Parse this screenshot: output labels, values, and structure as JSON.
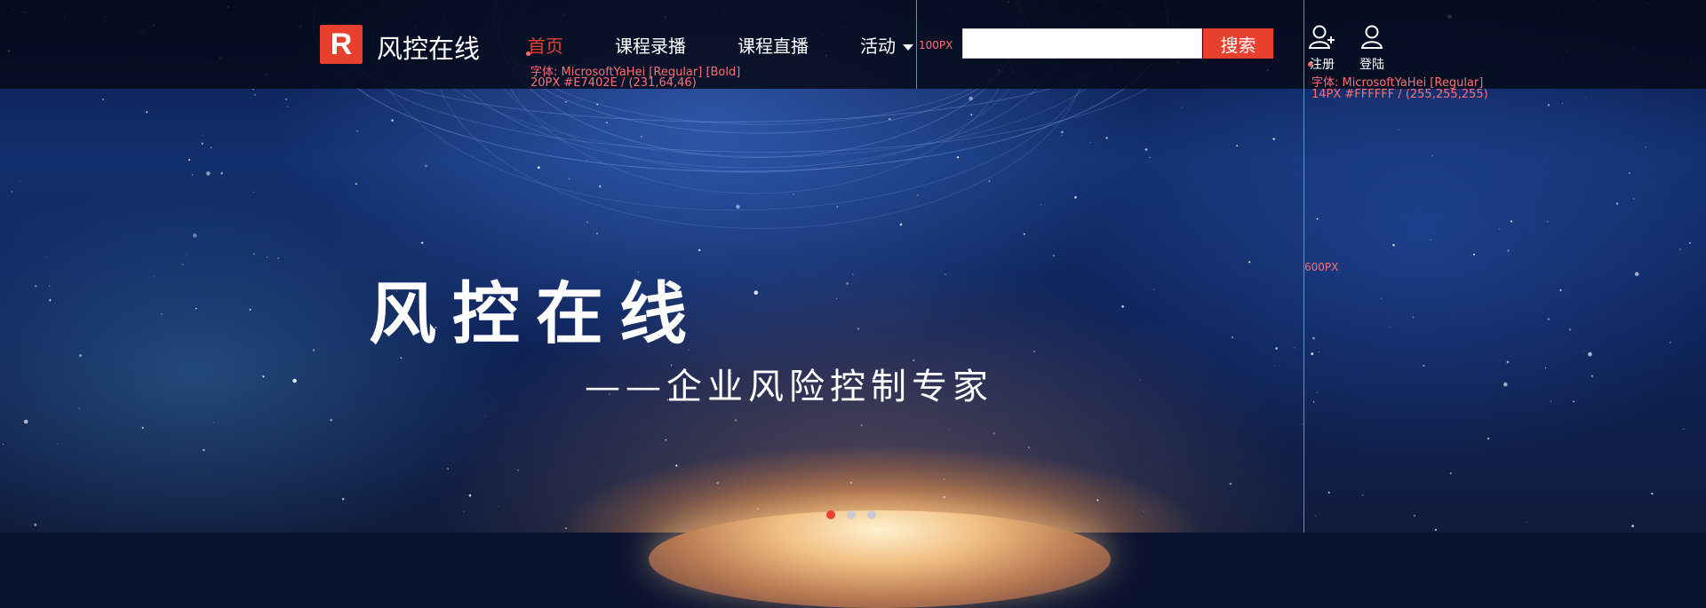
{
  "header": {
    "logo_letter": "R",
    "logo_text": "风控在线"
  },
  "nav": [
    {
      "label": "首页",
      "active": true
    },
    {
      "label": "课程录播",
      "active": false
    },
    {
      "label": "课程直播",
      "active": false
    },
    {
      "label": "活动",
      "active": false
    }
  ],
  "search": {
    "value": "",
    "button_label": "搜索"
  },
  "user": {
    "register_label": "注册",
    "login_label": "登陆"
  },
  "annotations": {
    "nav_font_line1": "字体: MicrosoftYaHei [Regular] [Bold]",
    "nav_font_line2": "20PX #E7402E / (231,64,46)",
    "height_100": "100PX",
    "user_font_line1": "字体: MicrosoftYaHei [Regular]",
    "user_font_line2": "14PX #FFFFFF / (255,255,255)",
    "height_600": "600PX"
  },
  "banner": {
    "title": "风控在线",
    "subtitle": "——企业风险控制专家",
    "active_slide": 0,
    "slide_count": 3
  },
  "colors": {
    "accent": "#E7402E",
    "text": "#FFFFFF"
  }
}
